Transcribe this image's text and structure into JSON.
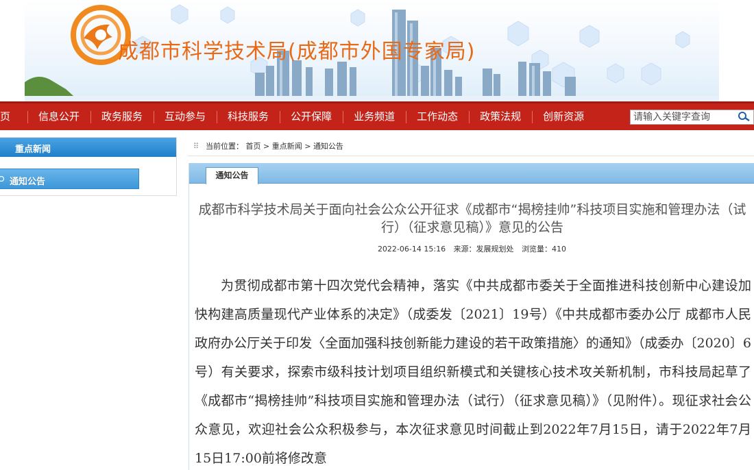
{
  "site": {
    "title": "成都市科学技术局(成都市外国专家局)",
    "brand_color": "#e86a17"
  },
  "nav": {
    "items": [
      "页",
      "信息公开",
      "政务服务",
      "互动参与",
      "科技服务",
      "公开保障",
      "业务频道",
      "工作动态",
      "政策法规",
      "创新资源"
    ],
    "bg_color": "#c4231a"
  },
  "search": {
    "placeholder": "请输入关键字查询",
    "icon": "search-icon"
  },
  "sidebar": {
    "header": "重点新闻",
    "items": [
      {
        "label": "通知公告",
        "active": true
      }
    ]
  },
  "breadcrumb": {
    "prefix": "当前位置：",
    "items": [
      "首页",
      "重点新闻",
      "通知公告"
    ],
    "separator": ">"
  },
  "panel": {
    "tab": "通知公告"
  },
  "article": {
    "title": "成都市科学技术局关于面向社会公众公开征求《成都市“揭榜挂帅”科技项目实施和管理办法（试行）（征求意见稿）》意见的公告",
    "date": "2022-06-14 15:16",
    "source": "来源：发展规划处",
    "views": "浏览量：410",
    "body": "为贯彻成都市第十四次党代会精神，落实《中共成都市委关于全面推进科技创新中心建设加快构建高质量现代产业体系的决定》（成委发〔2021〕19号）《中共成都市委办公厅 成都市人民政府办公厅关于印发〈全面加强科技创新能力建设的若干政策措施〉的通知》（成委办〔2020〕6号）有关要求，探索市级科技计划项目组织新模式和关键核心技术攻关新机制，市科技局起草了《成都市“揭榜挂帅”科技项目实施和管理办法（试行）（征求意见稿）》（见附件）。现征求社会公众意见，欢迎社会公众积极参与，本次征求意见时间截止到2022年7月15日，请于2022年7月15日17:00前将修改意"
  }
}
